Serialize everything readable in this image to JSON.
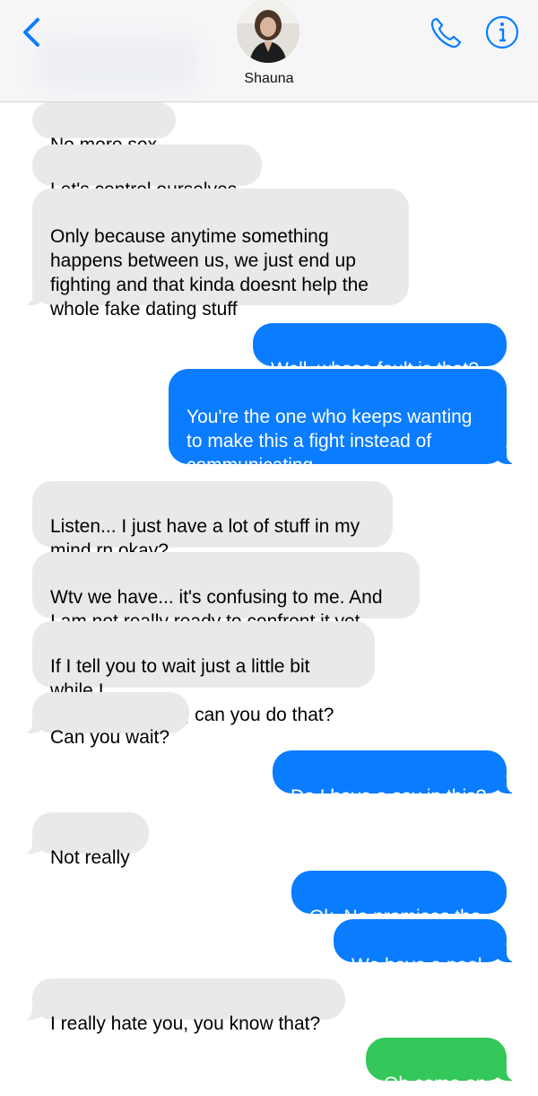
{
  "header": {
    "contact_name": "Shauna",
    "back_icon": "chevron-left-icon",
    "call_icon": "phone-icon",
    "info_icon": "info-icon",
    "accent_color": "#0a7cff"
  },
  "messages": [
    {
      "from": "them",
      "text": "No more sex"
    },
    {
      "from": "them",
      "text": "Let's control ourselves"
    },
    {
      "from": "them",
      "text": "Only because anytime something\nhappens between us, we just end up\nfighting and that kinda doesnt help the\nwhole fake dating stuff"
    },
    {
      "from": "me",
      "text": "Well, whose fault is that?"
    },
    {
      "from": "me",
      "text": "You're the one who keeps wanting\nto make this a fight instead of\ncommunicating"
    },
    {
      "from": "them",
      "text": "Listen... I just have a lot of stuff in my\nmind rn okay?"
    },
    {
      "from": "them",
      "text": "Wtv we have... it's confusing to me. And\nI am not really ready to.confront it yet."
    },
    {
      "from": "them",
      "text": "If I tell you to wait just a little bit while I\nfigure things out, can you do that?"
    },
    {
      "from": "them",
      "text": "Can you wait?"
    },
    {
      "from": "me",
      "text": "Do I have a say in this?"
    },
    {
      "from": "them",
      "text": "Not really"
    },
    {
      "from": "me",
      "text": "Ok. No promises tho"
    },
    {
      "from": "me",
      "text": "We have a pool"
    },
    {
      "from": "them",
      "text": "I really hate you, you know that?"
    },
    {
      "from": "me_sms",
      "text": "Oh come on"
    }
  ]
}
